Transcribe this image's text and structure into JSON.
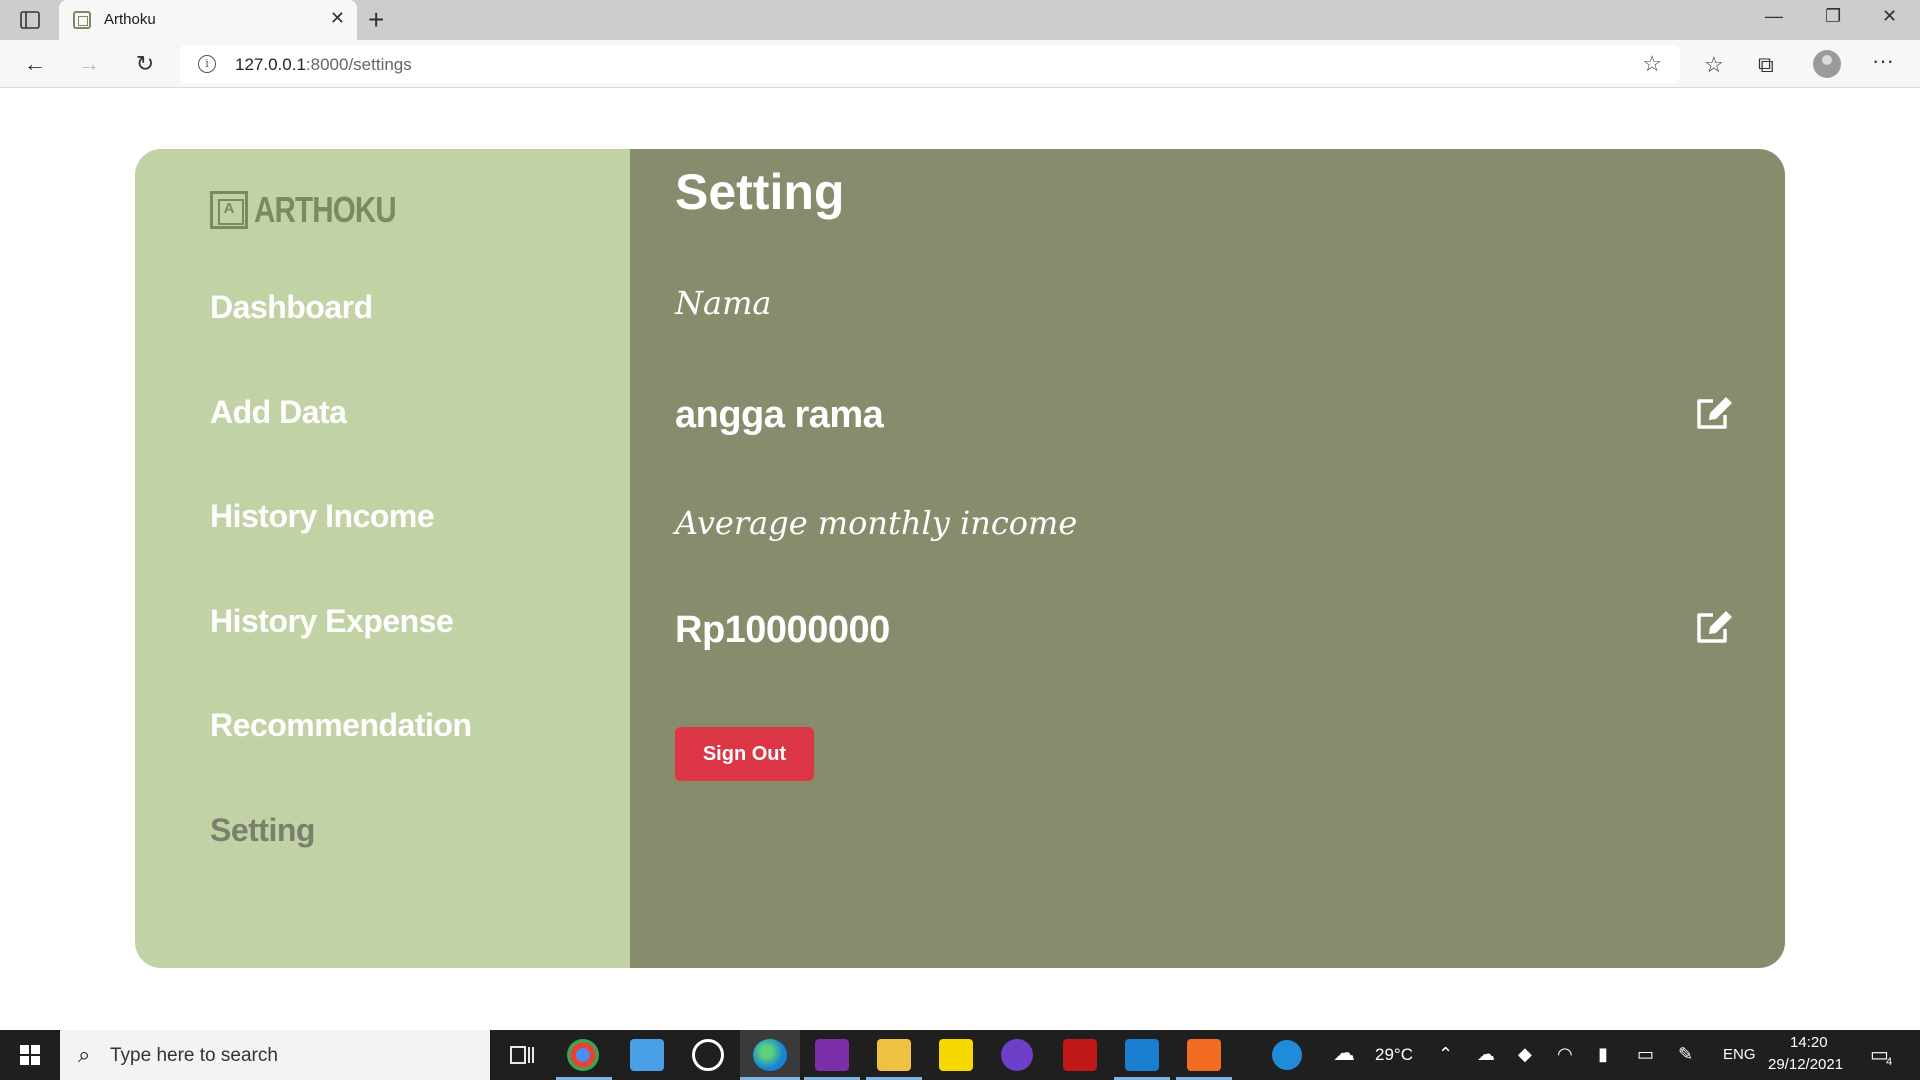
{
  "browser": {
    "tab_title": "Arthoku",
    "tab_close": "✕",
    "new_tab": "+",
    "url_host": "127.0.0.1",
    "url_rest": ":8000/settings",
    "window_controls": {
      "minimize": "—",
      "restore": "❐",
      "close": "✕"
    },
    "nav": {
      "back": "←",
      "forward": "→",
      "reload": "↻"
    },
    "icons": {
      "favorites_add": "☆",
      "favorites": "☆",
      "collections": "⧉",
      "more": "···"
    }
  },
  "brand": {
    "mark": "A",
    "name": "ARTHOKU"
  },
  "sidebar": {
    "items": [
      {
        "label": "Dashboard",
        "active": false
      },
      {
        "label": "Add Data",
        "active": false
      },
      {
        "label": "History Income",
        "active": false
      },
      {
        "label": "History Expense",
        "active": false
      },
      {
        "label": "Recommendation",
        "active": false
      },
      {
        "label": "Setting",
        "active": true
      }
    ]
  },
  "main": {
    "title": "Setting",
    "fields": [
      {
        "label": "Nama",
        "value": "angga rama"
      },
      {
        "label": "Average monthly income",
        "value": "Rp10000000"
      }
    ],
    "sign_out_label": "Sign Out"
  },
  "taskbar": {
    "search_placeholder": "Type here to search",
    "weather": "29°C",
    "language": "ENG",
    "time": "14:20",
    "date": "29/12/2021",
    "notifications": "4"
  },
  "colors": {
    "sidebar_bg": "#c1d2a4",
    "main_bg": "#878d6c",
    "signout_bg": "#dc3545",
    "active_nav": "#7a7f6e"
  }
}
